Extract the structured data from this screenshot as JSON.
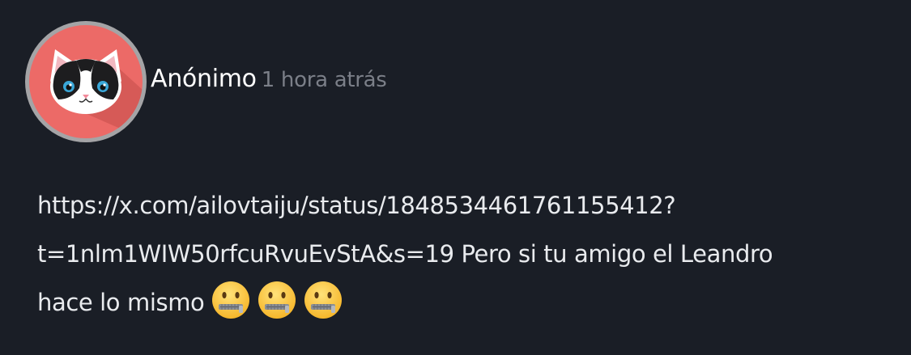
{
  "post": {
    "author": "Anónimo",
    "time": "1 hora atrás",
    "avatar_icon": "cat-face-icon",
    "avatar_bg": "#ec6a67",
    "lines": [
      "https://x.com/ailovtaiju/status/1848534461761155412?",
      "t=1nlm1WIW50rfcuRvuEvStA&s=19 Pero si tu amigo el Leandro",
      "hace lo mismo"
    ],
    "emojis": [
      "zipper-mouth-face-icon",
      "zipper-mouth-face-icon",
      "zipper-mouth-face-icon"
    ]
  }
}
